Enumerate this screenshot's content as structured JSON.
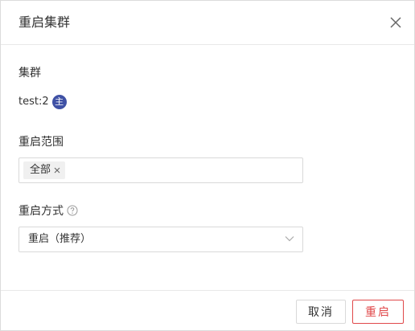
{
  "dialog": {
    "title": "重启集群",
    "close_icon": "close-icon"
  },
  "cluster": {
    "label": "集群",
    "name": "test:2",
    "role_badge": "主",
    "badge_color": "#3f51a5"
  },
  "restart_scope": {
    "label": "重启范围",
    "selected_tags": [
      "全部"
    ],
    "tag_remove_icon": "close-small-icon"
  },
  "restart_method": {
    "label": "重启方式",
    "help_icon": "question-circle-icon",
    "value": "重启（推荐）",
    "dropdown_icon": "chevron-down-icon"
  },
  "footer": {
    "cancel_label": "取消",
    "confirm_label": "重启",
    "confirm_color": "#e0484a"
  }
}
